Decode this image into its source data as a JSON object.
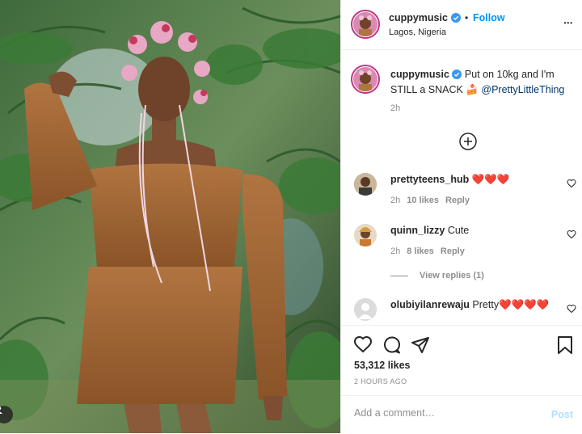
{
  "post": {
    "username": "cuppymusic",
    "follow_label": "Follow",
    "dot": "•",
    "location": "Lagos, Nigeria",
    "more": "•••"
  },
  "caption": {
    "username": "cuppymusic",
    "text": "Put on 10kg and I'm STILL a SNACK 🍰",
    "mention": "@PrettyLittleThing",
    "time": "2h"
  },
  "comments": [
    {
      "username": "prettyteens_hub",
      "text": "❤️❤️❤️",
      "time": "2h",
      "likes": "10 likes",
      "reply": "Reply"
    },
    {
      "username": "quinn_lizzy",
      "text": "Cute",
      "time": "2h",
      "likes": "8 likes",
      "reply": "Reply",
      "view_replies": "View replies (1)"
    },
    {
      "username": "olubiyilanrewaju",
      "text": "Pretty❤️❤️❤️❤️"
    }
  ],
  "actions": {
    "likes": "53,312 likes",
    "ago": "2 HOURS AGO",
    "comment_placeholder": "Add a comment…",
    "post_label": "Post"
  },
  "colors": {
    "accent": "#0095f6",
    "verified": "#3897f0",
    "post_disabled": "#b2dffc",
    "muted": "#8e8e8e",
    "heart": "#ed4956"
  },
  "icons": [
    "verified-icon",
    "more-icon",
    "load-more-icon",
    "heart-icon",
    "comment-icon",
    "share-icon",
    "bookmark-icon",
    "user-tag-icon"
  ]
}
